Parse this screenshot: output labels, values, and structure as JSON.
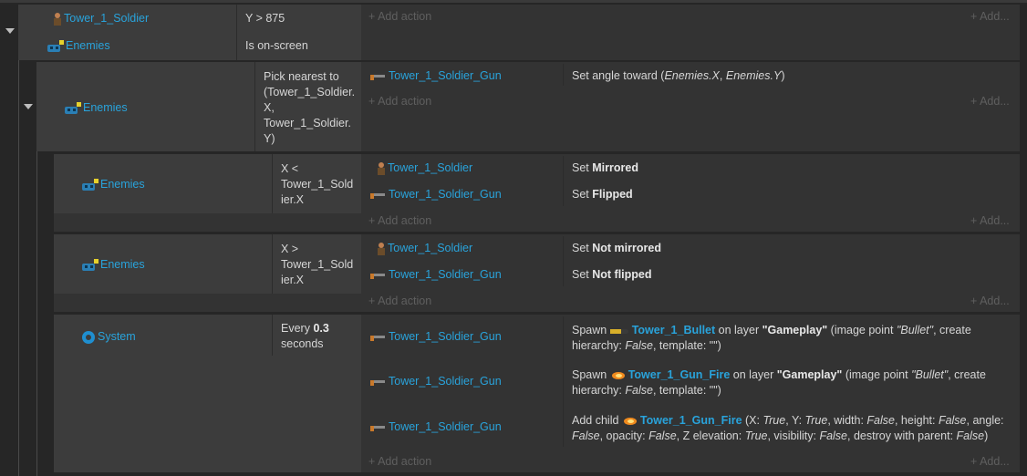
{
  "event1": {
    "conditions": [
      {
        "object": "Tower_1_Soldier",
        "text": "Y > 875"
      },
      {
        "object": "Enemies",
        "text": "Is on-screen"
      }
    ],
    "add_action": "Add action",
    "add": "Add..."
  },
  "event2": {
    "condition_object": "Enemies",
    "condition_text_lines": [
      "Pick nearest to",
      "(Tower_1_Soldier.",
      "X,",
      "Tower_1_Soldier.",
      "Y)"
    ],
    "action_object": "Tower_1_Soldier_Gun",
    "action_prefix": "Set angle toward (",
    "action_arg1": "Enemies.X",
    "action_sep": ", ",
    "action_arg2": "Enemies.Y",
    "action_suffix": ")",
    "add_action": "Add action",
    "add": "Add..."
  },
  "event3": {
    "condition_object": "Enemies",
    "condition_text_lines": [
      "X <",
      "Tower_1_Sold",
      "ier.X"
    ],
    "actions": [
      {
        "object": "Tower_1_Soldier",
        "prefix": "Set ",
        "bold": "Mirrored"
      },
      {
        "object": "Tower_1_Soldier_Gun",
        "prefix": "Set ",
        "bold": "Flipped"
      }
    ],
    "add_action": "Add action",
    "add": "Add..."
  },
  "event4": {
    "condition_object": "Enemies",
    "condition_text_lines": [
      "X >",
      "Tower_1_Sold",
      "ier.X"
    ],
    "actions": [
      {
        "object": "Tower_1_Soldier",
        "prefix": "Set ",
        "bold": "Not mirrored"
      },
      {
        "object": "Tower_1_Soldier_Gun",
        "prefix": "Set ",
        "bold": "Not flipped"
      }
    ],
    "add_action": "Add action",
    "add": "Add..."
  },
  "event5": {
    "condition_object": "System",
    "condition_prefix": "Every ",
    "condition_bold": "0.3",
    "condition_suffix": "seconds",
    "actions": [
      {
        "object": "Tower_1_Soldier_Gun",
        "spawn": "Spawn ",
        "target": "Tower_1_Bullet",
        "on_layer": " on layer ",
        "layer": "\"Gameplay\"",
        "rest1": " (image point ",
        "point": "\"Bullet\"",
        "rest2": ", create",
        "line2a": "hierarchy: ",
        "line2b": "False",
        "line2c": ", template: \"\")"
      },
      {
        "object": "Tower_1_Soldier_Gun",
        "spawn": "Spawn ",
        "target": "Tower_1_Gun_Fire",
        "on_layer": " on layer ",
        "layer": "\"Gameplay\"",
        "rest1": " (image point ",
        "point": "\"Bullet\"",
        "rest2": ", create",
        "line2a": "hierarchy: ",
        "line2b": "False",
        "line2c": ", template: \"\")"
      },
      {
        "object": "Tower_1_Soldier_Gun",
        "prefix": "Add child ",
        "target": "Tower_1_Gun_Fire",
        "l1a": " (X: ",
        "l1b": "True",
        "l1c": ", Y: ",
        "l1d": "True",
        "l1e": ", width: ",
        "l1f": "False",
        "l1g": ", height: ",
        "l1h": "False",
        "l1i": ", angle:",
        "l2a": "False",
        "l2b": ", opacity: ",
        "l2c": "False",
        "l2d": ", Z elevation: ",
        "l2e": "True",
        "l2f": ", visibility: ",
        "l2g": "False",
        "l2h": ", destroy with parent: ",
        "l2i": "False",
        "l2j": ")"
      }
    ],
    "add_action": "Add action",
    "add": "Add..."
  },
  "colors": {
    "object_link": "#29a3db",
    "panel": "#333333",
    "condition_panel": "#3c3c3c",
    "background": "#262626"
  }
}
